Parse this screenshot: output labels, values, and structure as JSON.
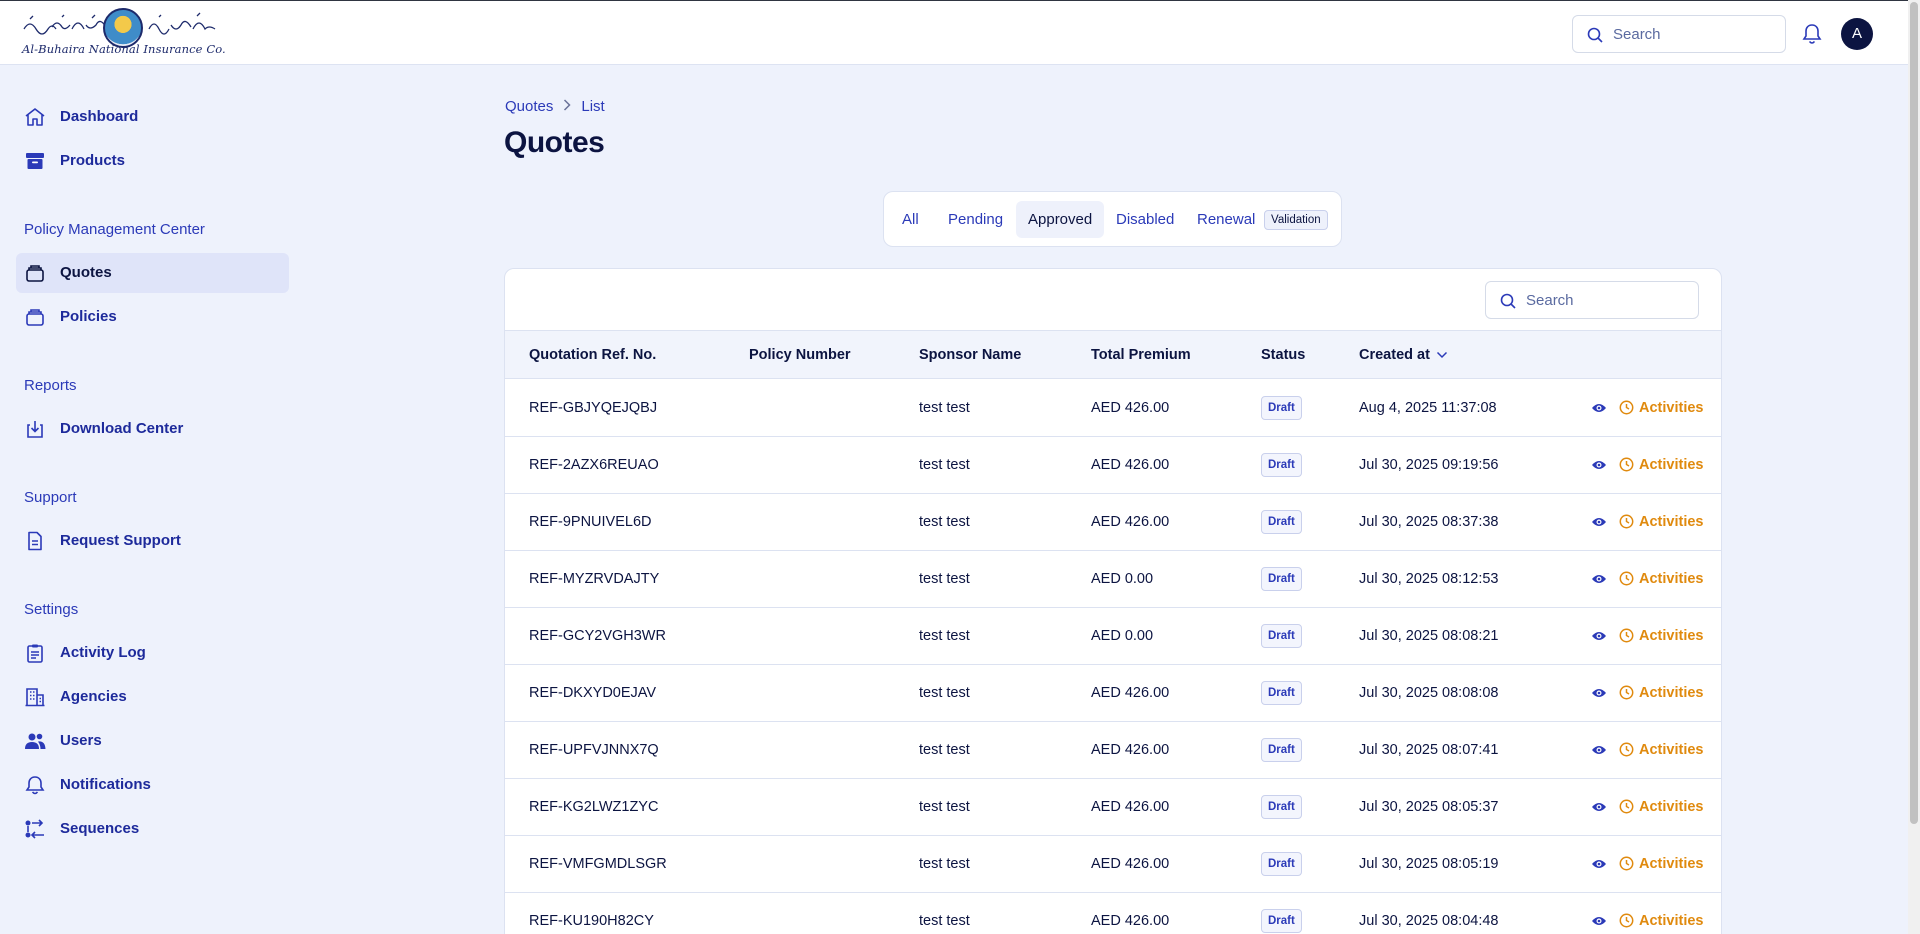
{
  "brand": {
    "logo_text": "Al-Buhaira National Insurance Co."
  },
  "topbar": {
    "search_placeholder": "Search",
    "avatar_initial": "A"
  },
  "sidebar": {
    "items_top": [
      {
        "label": "Dashboard",
        "icon": "home-icon"
      },
      {
        "label": "Products",
        "icon": "archive-icon"
      }
    ],
    "section_policy": "Policy Management Center",
    "items_policy": [
      {
        "label": "Quotes",
        "icon": "stack-icon",
        "active": true
      },
      {
        "label": "Policies",
        "icon": "stack-icon"
      }
    ],
    "section_reports": "Reports",
    "items_reports": [
      {
        "label": "Download Center",
        "icon": "download-icon"
      }
    ],
    "section_support": "Support",
    "items_support": [
      {
        "label": "Request Support",
        "icon": "document-icon"
      }
    ],
    "section_settings": "Settings",
    "items_settings": [
      {
        "label": "Activity Log",
        "icon": "clipboard-icon"
      },
      {
        "label": "Agencies",
        "icon": "building-icon"
      },
      {
        "label": "Users",
        "icon": "users-icon"
      },
      {
        "label": "Notifications",
        "icon": "bell-icon"
      },
      {
        "label": "Sequences",
        "icon": "sequence-icon"
      }
    ]
  },
  "breadcrumb": {
    "root": "Quotes",
    "current": "List"
  },
  "page": {
    "title": "Quotes"
  },
  "tabs": {
    "items": [
      "All",
      "Pending",
      "Approved",
      "Disabled",
      "Renewal"
    ],
    "active": "Approved",
    "badge": "Validation"
  },
  "table": {
    "search_placeholder": "Search",
    "columns": [
      "Quotation Ref. No.",
      "Policy Number",
      "Sponsor Name",
      "Total Premium",
      "Status",
      "Created at"
    ],
    "sorted_column": "Created at",
    "action_label": "Activities",
    "rows": [
      {
        "ref": "REF-GBJYQEJQBJ",
        "policy": "",
        "sponsor": "test test",
        "premium": "AED 426.00",
        "status": "Draft",
        "created": "Aug 4, 2025 11:37:08"
      },
      {
        "ref": "REF-2AZX6REUAO",
        "policy": "",
        "sponsor": "test test",
        "premium": "AED 426.00",
        "status": "Draft",
        "created": "Jul 30, 2025 09:19:56"
      },
      {
        "ref": "REF-9PNUIVEL6D",
        "policy": "",
        "sponsor": "test test",
        "premium": "AED 426.00",
        "status": "Draft",
        "created": "Jul 30, 2025 08:37:38"
      },
      {
        "ref": "REF-MYZRVDAJTY",
        "policy": "",
        "sponsor": "test test",
        "premium": "AED 0.00",
        "status": "Draft",
        "created": "Jul 30, 2025 08:12:53"
      },
      {
        "ref": "REF-GCY2VGH3WR",
        "policy": "",
        "sponsor": "test test",
        "premium": "AED 0.00",
        "status": "Draft",
        "created": "Jul 30, 2025 08:08:21"
      },
      {
        "ref": "REF-DKXYD0EJAV",
        "policy": "",
        "sponsor": "test test",
        "premium": "AED 426.00",
        "status": "Draft",
        "created": "Jul 30, 2025 08:08:08"
      },
      {
        "ref": "REF-UPFVJNNX7Q",
        "policy": "",
        "sponsor": "test test",
        "premium": "AED 426.00",
        "status": "Draft",
        "created": "Jul 30, 2025 08:07:41"
      },
      {
        "ref": "REF-KG2LWZ1ZYC",
        "policy": "",
        "sponsor": "test test",
        "premium": "AED 426.00",
        "status": "Draft",
        "created": "Jul 30, 2025 08:05:37"
      },
      {
        "ref": "REF-VMFGMDLSGR",
        "policy": "",
        "sponsor": "test test",
        "premium": "AED 426.00",
        "status": "Draft",
        "created": "Jul 30, 2025 08:05:19"
      },
      {
        "ref": "REF-KU190H82CY",
        "policy": "",
        "sponsor": "test test",
        "premium": "AED 426.00",
        "status": "Draft",
        "created": "Jul 30, 2025 08:04:48"
      }
    ]
  },
  "colors": {
    "brand_navy": "#0c1441",
    "link_blue": "#2b3ab8",
    "accent_orange": "#e08a0e",
    "background": "#eef2fc"
  }
}
